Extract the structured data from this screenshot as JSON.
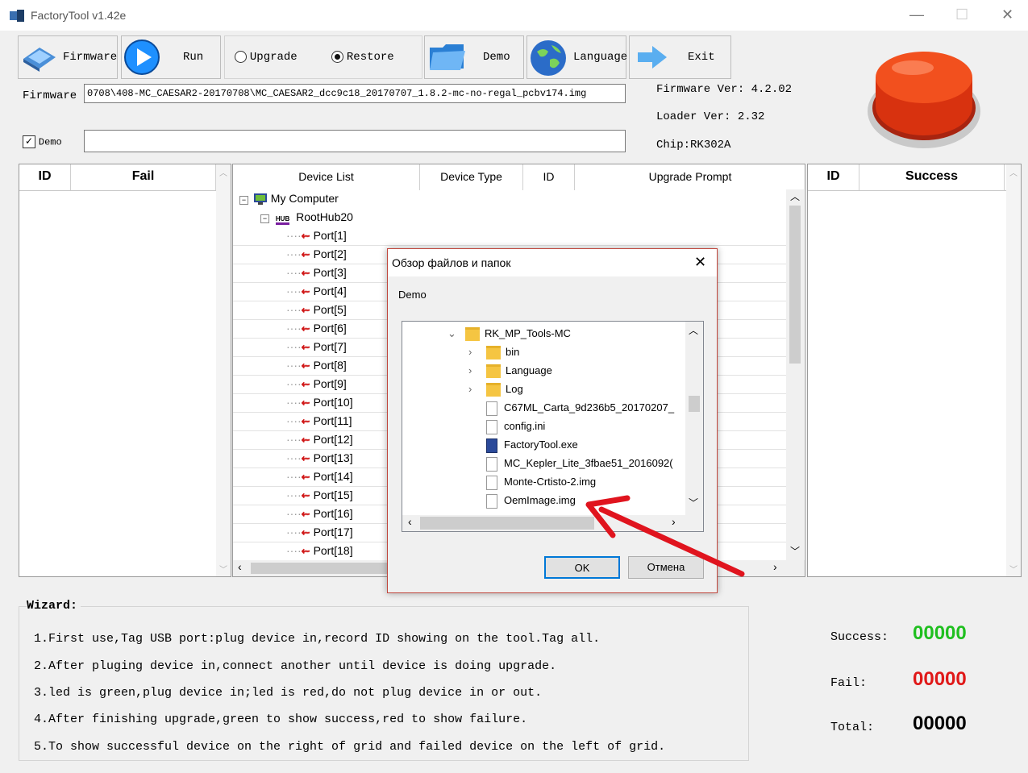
{
  "window": {
    "title": "FactoryTool v1.42e",
    "minimize": "—",
    "maximize": "☐",
    "close": "✕"
  },
  "toolbar": {
    "firmware": "Firmware",
    "run": "Run",
    "upgrade": "Upgrade",
    "restore": "Restore",
    "mode_selected": "restore",
    "demo": "Demo",
    "language": "Language",
    "exit": "Exit"
  },
  "firmware": {
    "label": "Firmware",
    "path": "0708\\408-MC_CAESAR2-20170708\\MC_CAESAR2_dcc9c18_20170707_1.8.2-mc-no-regal_pcbv174.img",
    "fw_ver_label": "Firmware Ver:",
    "fw_ver": "4.2.02",
    "loader_ver_label": "Loader Ver:",
    "loader_ver": "2.32",
    "chip_label": "Chip:",
    "chip": "RK302A"
  },
  "demo": {
    "label": "Demo",
    "checked": true
  },
  "fail_grid": {
    "col_id": "ID",
    "col_fail": "Fail"
  },
  "success_grid": {
    "col_id": "ID",
    "col_success": "Success"
  },
  "device_list": {
    "columns": [
      "Device List",
      "Device Type",
      "ID",
      "Upgrade Prompt"
    ],
    "computer": "My Computer",
    "hub_icon": "HUB",
    "hub": "RootHub20",
    "ports": [
      "Port[1]",
      "Port[2]",
      "Port[3]",
      "Port[4]",
      "Port[5]",
      "Port[6]",
      "Port[7]",
      "Port[8]",
      "Port[9]",
      "Port[10]",
      "Port[11]",
      "Port[12]",
      "Port[13]",
      "Port[14]",
      "Port[15]",
      "Port[16]",
      "Port[17]",
      "Port[18]"
    ]
  },
  "dialog": {
    "title": "Обзор файлов и папок",
    "subtitle": "Demo",
    "items": [
      {
        "name": "RK_MP_Tools-MC",
        "kind": "folder",
        "expand": "open",
        "level": 0
      },
      {
        "name": "bin",
        "kind": "folder",
        "expand": "closed",
        "level": 1
      },
      {
        "name": "Language",
        "kind": "folder",
        "expand": "closed",
        "level": 1
      },
      {
        "name": "Log",
        "kind": "folder",
        "expand": "closed",
        "level": 1
      },
      {
        "name": "C67ML_Carta_9d236b5_20170207_",
        "kind": "file",
        "level": 1
      },
      {
        "name": "config.ini",
        "kind": "file",
        "level": 1
      },
      {
        "name": "FactoryTool.exe",
        "kind": "exe",
        "level": 1
      },
      {
        "name": "MC_Kepler_Lite_3fbae51_2016092(",
        "kind": "file",
        "level": 1
      },
      {
        "name": "Monte-Crtisto-2.img",
        "kind": "file",
        "level": 1
      },
      {
        "name": "OemImage.img",
        "kind": "file",
        "level": 1
      }
    ],
    "ok": "OK",
    "cancel": "Отмена"
  },
  "wizard": {
    "title": "Wizard:",
    "lines": [
      "1.First use,Tag USB port:plug device in,record ID showing on the tool.Tag all.",
      "2.After pluging device in,connect another until device is doing upgrade.",
      "3.led is green,plug device in;led is red,do not plug device in or out.",
      "4.After finishing upgrade,green to show success,red to show failure.",
      "5.To show successful device on the right of grid and failed device on the left of grid."
    ]
  },
  "stats": {
    "success_label": "Success:",
    "success": "00000",
    "success_color": "#1fbf1f",
    "fail_label": "Fail:",
    "fail": "00000",
    "fail_color": "#e01818",
    "total_label": "Total:",
    "total": "00000"
  },
  "colors": {
    "annotation_arrow": "#e0141e",
    "run_button": "#1e90ff",
    "big_button": "#e8380f"
  },
  "icons": [
    "firmware-icon",
    "run-icon",
    "demo-folder-icon",
    "globe-icon",
    "exit-arrow-icon",
    "big-red-button"
  ]
}
